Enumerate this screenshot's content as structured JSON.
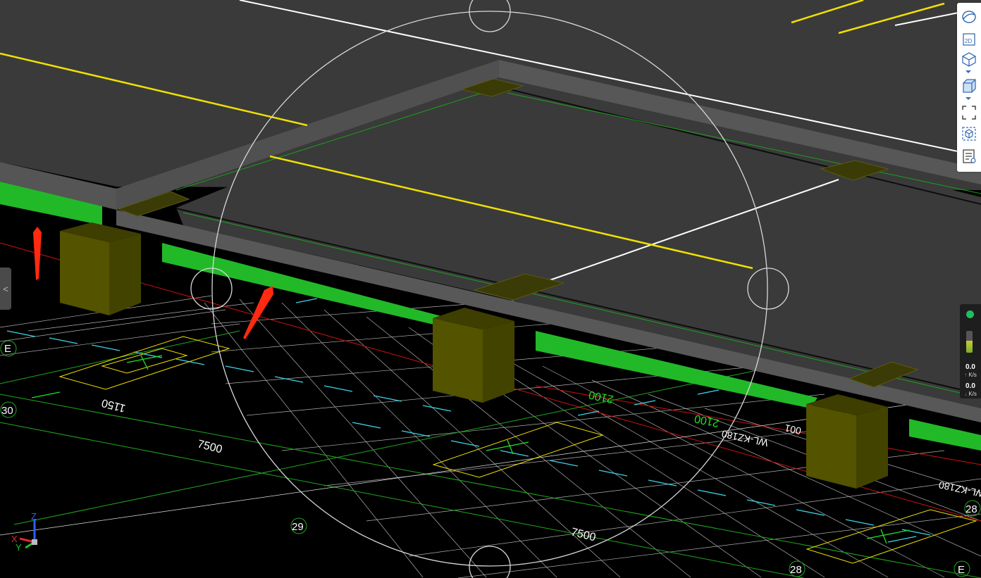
{
  "viewport": {
    "dimensions": {
      "d1": "1150",
      "d2": "7500",
      "d3": "7500",
      "d4": "2100",
      "d5": "2100",
      "d6": "001",
      "d7": "WL-KZ180",
      "d8": "WL-KZ180"
    },
    "axis_labels": {
      "a1": "E",
      "a2": "30",
      "a3": "29",
      "a4": "28",
      "a5": "28",
      "a6": "E"
    },
    "gizmo": {
      "x": "X",
      "y": "Y",
      "z": "Z"
    }
  },
  "toolbar": {
    "items": [
      {
        "name": "orbit-icon"
      },
      {
        "name": "view-2d-icon",
        "label": "2D"
      },
      {
        "name": "view-3d-icon"
      },
      {
        "name": "solid-cube-icon"
      },
      {
        "name": "fit-frame-icon"
      },
      {
        "name": "section-box-icon"
      },
      {
        "name": "properties-icon"
      }
    ]
  },
  "left_tab": {
    "glyph": "<"
  },
  "status": {
    "indicator_color": "#1fbf5f",
    "memory_fill": 0.55,
    "upload_rate": "0.0",
    "upload_unit": "K/s",
    "download_rate": "0.0",
    "download_unit": "K/s"
  },
  "colors": {
    "slab": "#3a3a3a",
    "slab_edge": "#555555",
    "beam_green": "#22b928",
    "column": "#535300",
    "grid_line": "#cfcfcf",
    "axis_red": "#d01010",
    "cyan": "#3ad3e8",
    "yellow": "#f0e000"
  }
}
